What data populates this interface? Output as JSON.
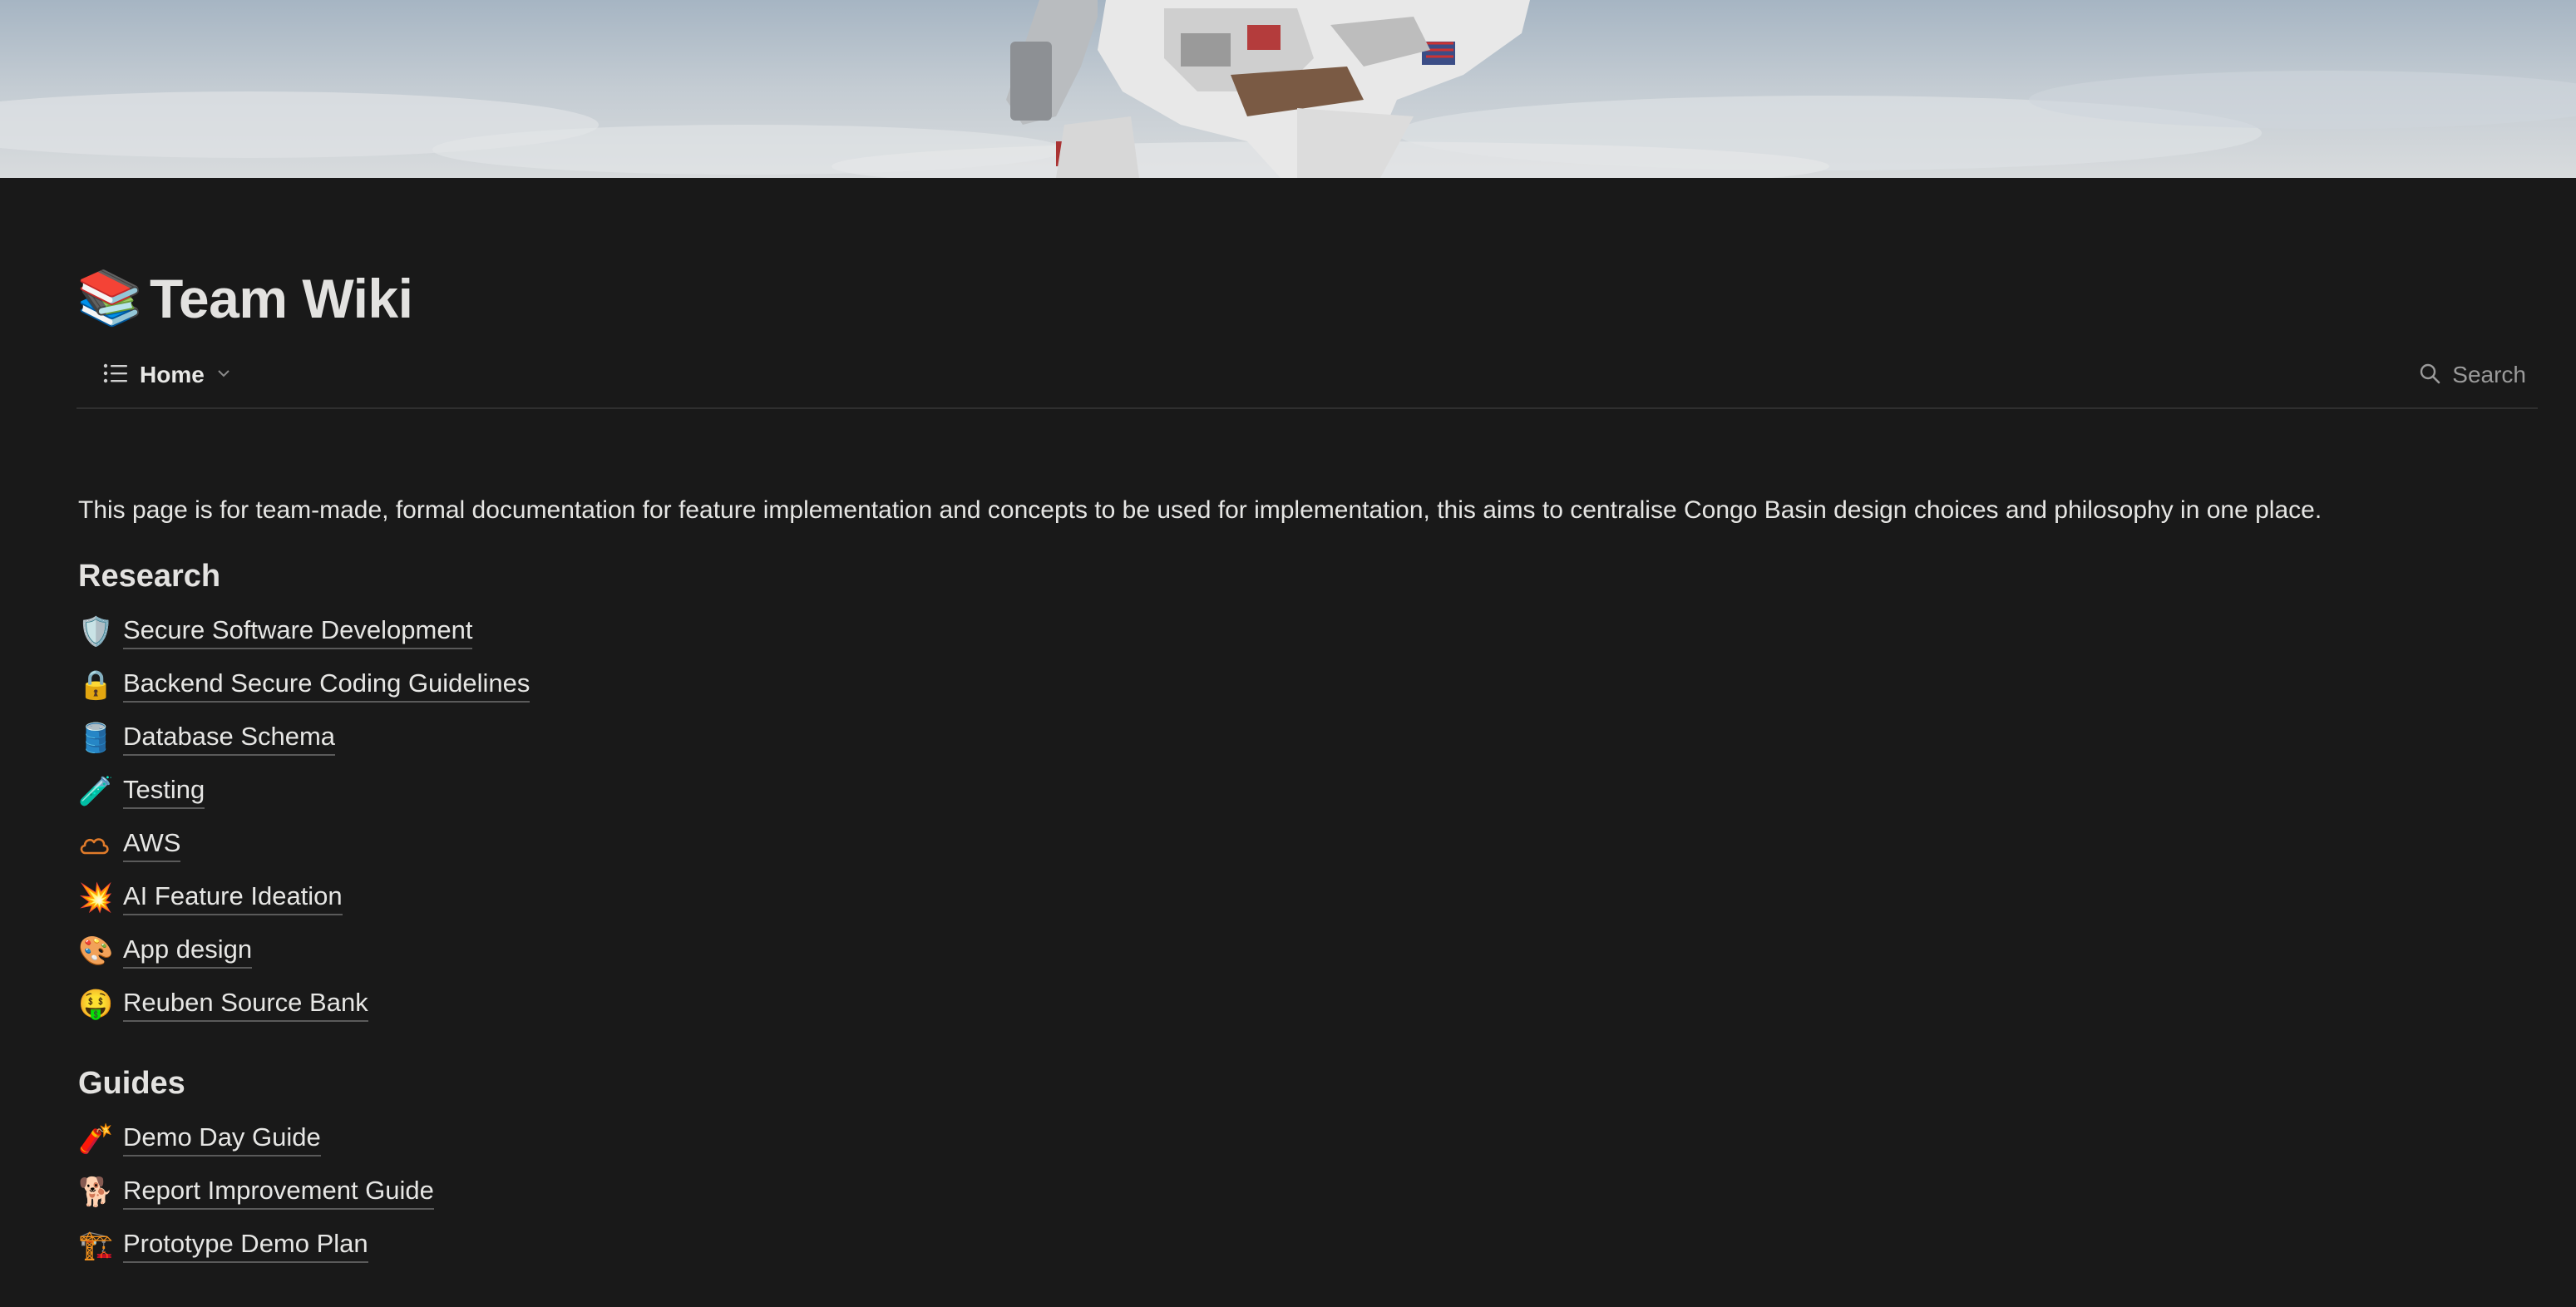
{
  "page": {
    "title_emoji": "📚",
    "title": "Team Wiki"
  },
  "view_bar": {
    "view_label": "Home",
    "search_label": "Search"
  },
  "intro_text": "This page is for team-made, formal documentation for feature implementation and concepts to be used for implementation, this aims to centralise Congo Basin design choices and philosophy in one place.",
  "research": {
    "heading": "Research",
    "items": [
      {
        "emoji": "🛡️",
        "label": "Secure Software Development"
      },
      {
        "emoji": "🔒",
        "label": "Backend Secure Coding Guidelines"
      },
      {
        "emoji": "🛢️",
        "label": "Database Schema"
      },
      {
        "emoji": "🧪",
        "label": "Testing"
      },
      {
        "emoji": "☁",
        "label": "AWS"
      },
      {
        "emoji": "💥",
        "label": "AI Feature Ideation"
      },
      {
        "emoji": "🎨",
        "label": "App design"
      },
      {
        "emoji": "🤑",
        "label": "Reuben Source Bank"
      }
    ]
  },
  "guides": {
    "heading": "Guides",
    "items": [
      {
        "emoji": "🧨",
        "label": "Demo Day Guide"
      },
      {
        "emoji": "🐕",
        "label": "Report Improvement Guide"
      },
      {
        "emoji": "🏗️",
        "label": "Prototype Demo Plan"
      }
    ]
  },
  "colors": {
    "background": "#191919",
    "text": "#e6e6e4",
    "muted": "#9b9b9b",
    "divider": "#2f2f2f",
    "aws_cloud": "#e07b2a"
  }
}
